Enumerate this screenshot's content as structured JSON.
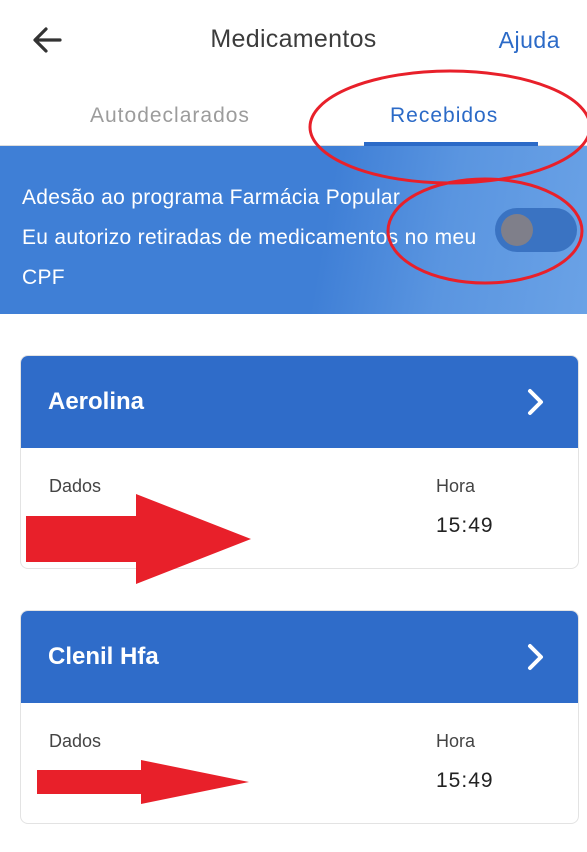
{
  "header": {
    "title": "Medicamentos",
    "help_label": "Ajuda",
    "back_icon": "arrow-left-icon"
  },
  "tabs": [
    {
      "label": "Autodeclarados",
      "active": false
    },
    {
      "label": "Recebidos",
      "active": true
    }
  ],
  "banner": {
    "line1": "Adesão ao programa Farmácia Popular",
    "line2": "Eu autorizo retiradas de medicamentos no meu CPF",
    "toggle_on": false
  },
  "cards": [
    {
      "title": "Aerolina",
      "left_label": "Dados",
      "right_label": "Hora",
      "time": "15:49"
    },
    {
      "title": "Clenil Hfa",
      "left_label": "Dados",
      "right_label": "Hora",
      "time": "15:49"
    }
  ],
  "colors": {
    "primary": "#2f6cc9",
    "link": "#2b6ac7",
    "annotation": "#e8202a"
  }
}
